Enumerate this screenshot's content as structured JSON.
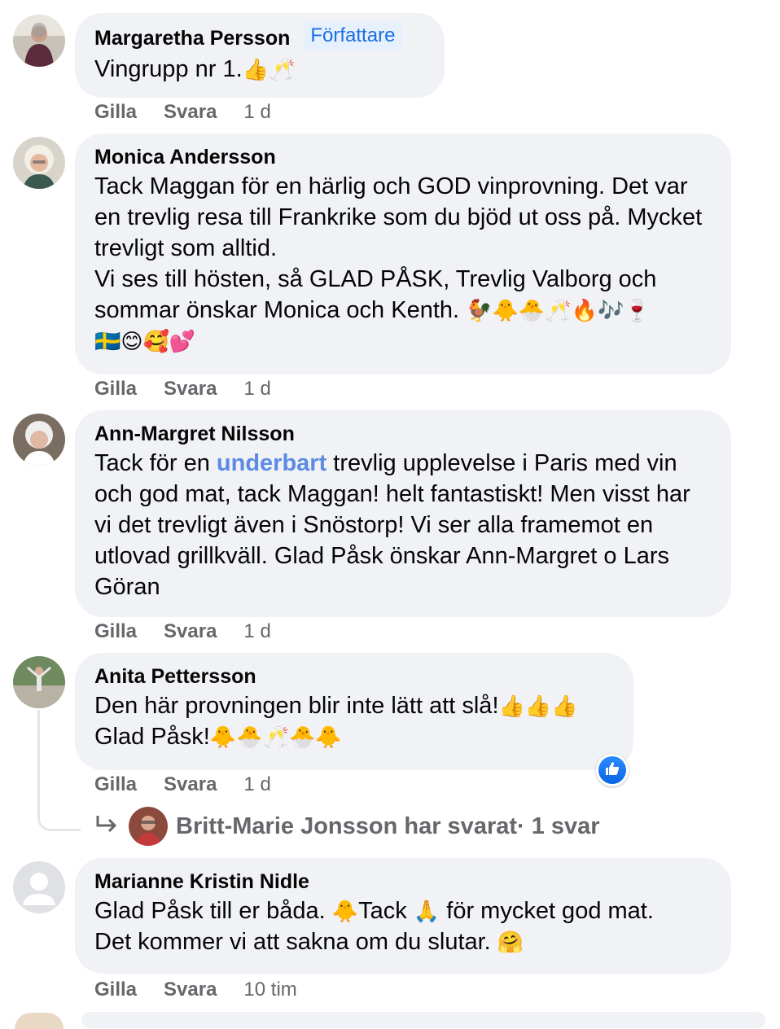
{
  "comments": [
    {
      "author": "Margaretha Persson",
      "badge": "Författare",
      "text": "Vingrupp nr 1.",
      "emoji": "👍🥂",
      "like_label": "Gilla",
      "reply_label": "Svara",
      "time": "1 d"
    },
    {
      "author": "Monica Andersson",
      "text": "Tack Maggan för en härlig och GOD vinprovning. Det var en trevlig resa till Frankrike som du bjöd ut oss på. Mycket trevligt som alltid.\nVi ses till hösten, så GLAD PÅSK, Trevlig Valborg och sommar önskar Monica och Kenth. ",
      "emoji": "🐓🐥🐣🥂🔥🎶🍷\n🇸🇪😊🥰💕",
      "like_label": "Gilla",
      "reply_label": "Svara",
      "time": "1 d"
    },
    {
      "author": "Ann-Margret Nilsson",
      "text_before": "Tack för en ",
      "link": "underbart",
      "text_after": " trevlig upplevelse i Paris med vin och god mat, tack Maggan! helt fantastiskt! Men visst har vi det trevligt även i Snöstorp! Vi ser alla framemot en utlovad grillkväll. Glad Påsk önskar Ann-Margret o Lars Göran",
      "like_label": "Gilla",
      "reply_label": "Svara",
      "time": "1 d"
    },
    {
      "author": "Anita Pettersson",
      "text_line1": "Den här provningen blir inte lätt att slå!",
      "emoji_line1": "👍👍👍",
      "text_line2": "Glad Påsk!",
      "emoji_line2": "🐥🐣🥂🐣🐥",
      "like_label": "Gilla",
      "reply_label": "Svara",
      "time": "1 d",
      "reaction": "like",
      "reply_summary": {
        "text": "Britt-Marie Jonsson har svarat",
        "count": " · 1 svar"
      }
    },
    {
      "author": "Marianne Kristin Nidle",
      "text_line1a": "Glad Påsk till er båda. ",
      "emoji_a": "🐥",
      "text_line1b": "Tack ",
      "emoji_b": "🙏",
      "text_line1c": " för mycket god mat.",
      "text_line2": "Det kommer vi att sakna om du slutar. ",
      "emoji_line2": "🤗",
      "like_label": "Gilla",
      "reply_label": "Svara",
      "time": "10 tim"
    }
  ],
  "colors": {
    "bubble": "#f0f2f5",
    "meta": "#65676b",
    "badge_bg": "#e7f0fd",
    "badge_text": "#1b6fe0",
    "link": "#5b8be3",
    "like": "#0a66e4"
  }
}
